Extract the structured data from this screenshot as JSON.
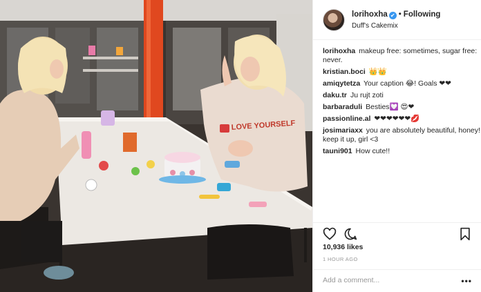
{
  "post": {
    "username": "lorihoxha",
    "verified_glyph": "✔",
    "separator": "•",
    "following_label": "Following",
    "location": "Duff's Cakemix",
    "comments": [
      {
        "user": "lorihoxha",
        "text": "makeup free: sometimes, sugar free: never."
      },
      {
        "user": "kristian.boci",
        "text": "👑👑"
      },
      {
        "user": "amiqytetza",
        "text": "Your caption 😂! Goals ❤❤"
      },
      {
        "user": "daku.tr",
        "text": "Ju rujt zoti"
      },
      {
        "user": "barbaraduli",
        "text": "Besties💟 😍❤"
      },
      {
        "user": "passionline.al",
        "text": "❤❤❤❤❤❤💋"
      },
      {
        "user": "josimariaxx",
        "text": "you are absolutely beautiful, honey! keep it up, girl <3"
      },
      {
        "user": "tauni901",
        "text": "How cute!!"
      }
    ],
    "likes": "10,936 likes",
    "time": "1 HOUR AGO",
    "add_comment_placeholder": "Add a comment...",
    "more_glyph": "•••"
  },
  "photo": {
    "sweatshirt_text": "LOVE YOURSELF"
  },
  "colors": {
    "link_blue": "#3897f0",
    "border": "#efefef",
    "muted": "#999999"
  }
}
